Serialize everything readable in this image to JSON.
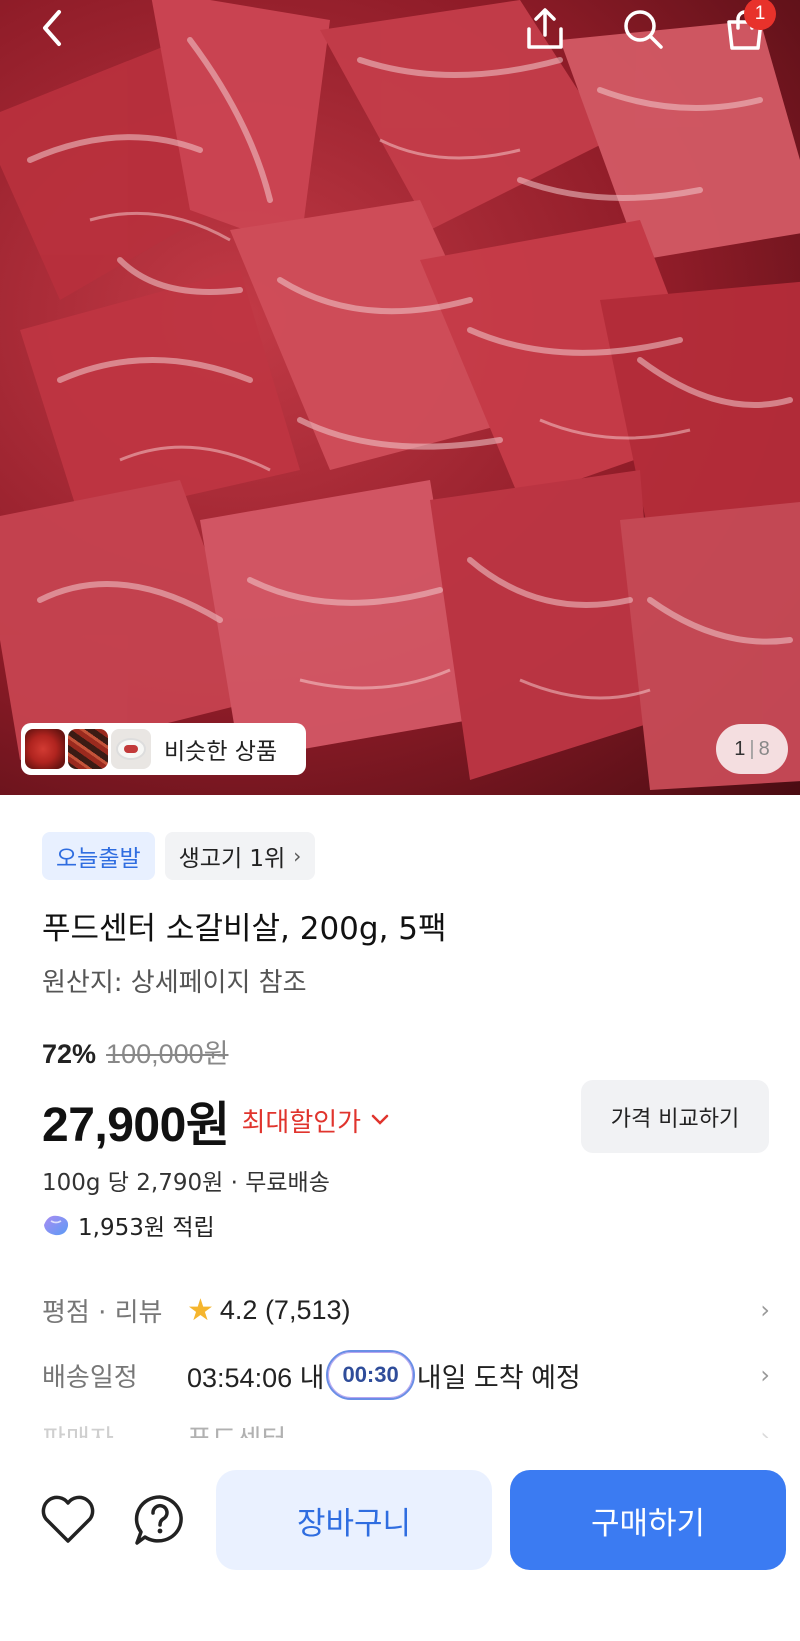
{
  "header": {
    "back_icon": "chevron-left-icon",
    "share_icon": "share-icon",
    "search_icon": "search-icon",
    "cart_icon": "shopping-bag-icon",
    "cart_badge": "1"
  },
  "gallery": {
    "similar_label": "비슷한 상품",
    "current_page": "1",
    "separator": "|",
    "total_pages": "8"
  },
  "product": {
    "badges": [
      "오늘출발",
      "생고기 1위"
    ],
    "title": "푸드센터 소갈비살, 200g, 5팩",
    "origin": "원산지: 상세페이지 참조",
    "discount_percent": "72%",
    "original_price": "100,000원",
    "price": "27,900원",
    "max_discount_label": "최대할인가",
    "compare_label": "가격 비교하기",
    "unit_price": "100g 당 2,790원 · 무료배송",
    "points": "1,953원 적립"
  },
  "info": {
    "rating_label": "평점 · 리뷰",
    "rating_value": "4.2 (7,513)",
    "delivery_label": "배송일정",
    "delivery_countdown": "03:54:06 내",
    "delivery_timer": "00:30",
    "delivery_text": "내일 도착 예정",
    "seller_label": "판매자",
    "seller_value": "푸드센터"
  },
  "bottom_bar": {
    "cart_label": "장바구니",
    "buy_label": "구매하기"
  },
  "colors": {
    "accent_blue": "#3b7bf2",
    "discount_red": "#e0342d",
    "badge_red": "#e8322b"
  }
}
